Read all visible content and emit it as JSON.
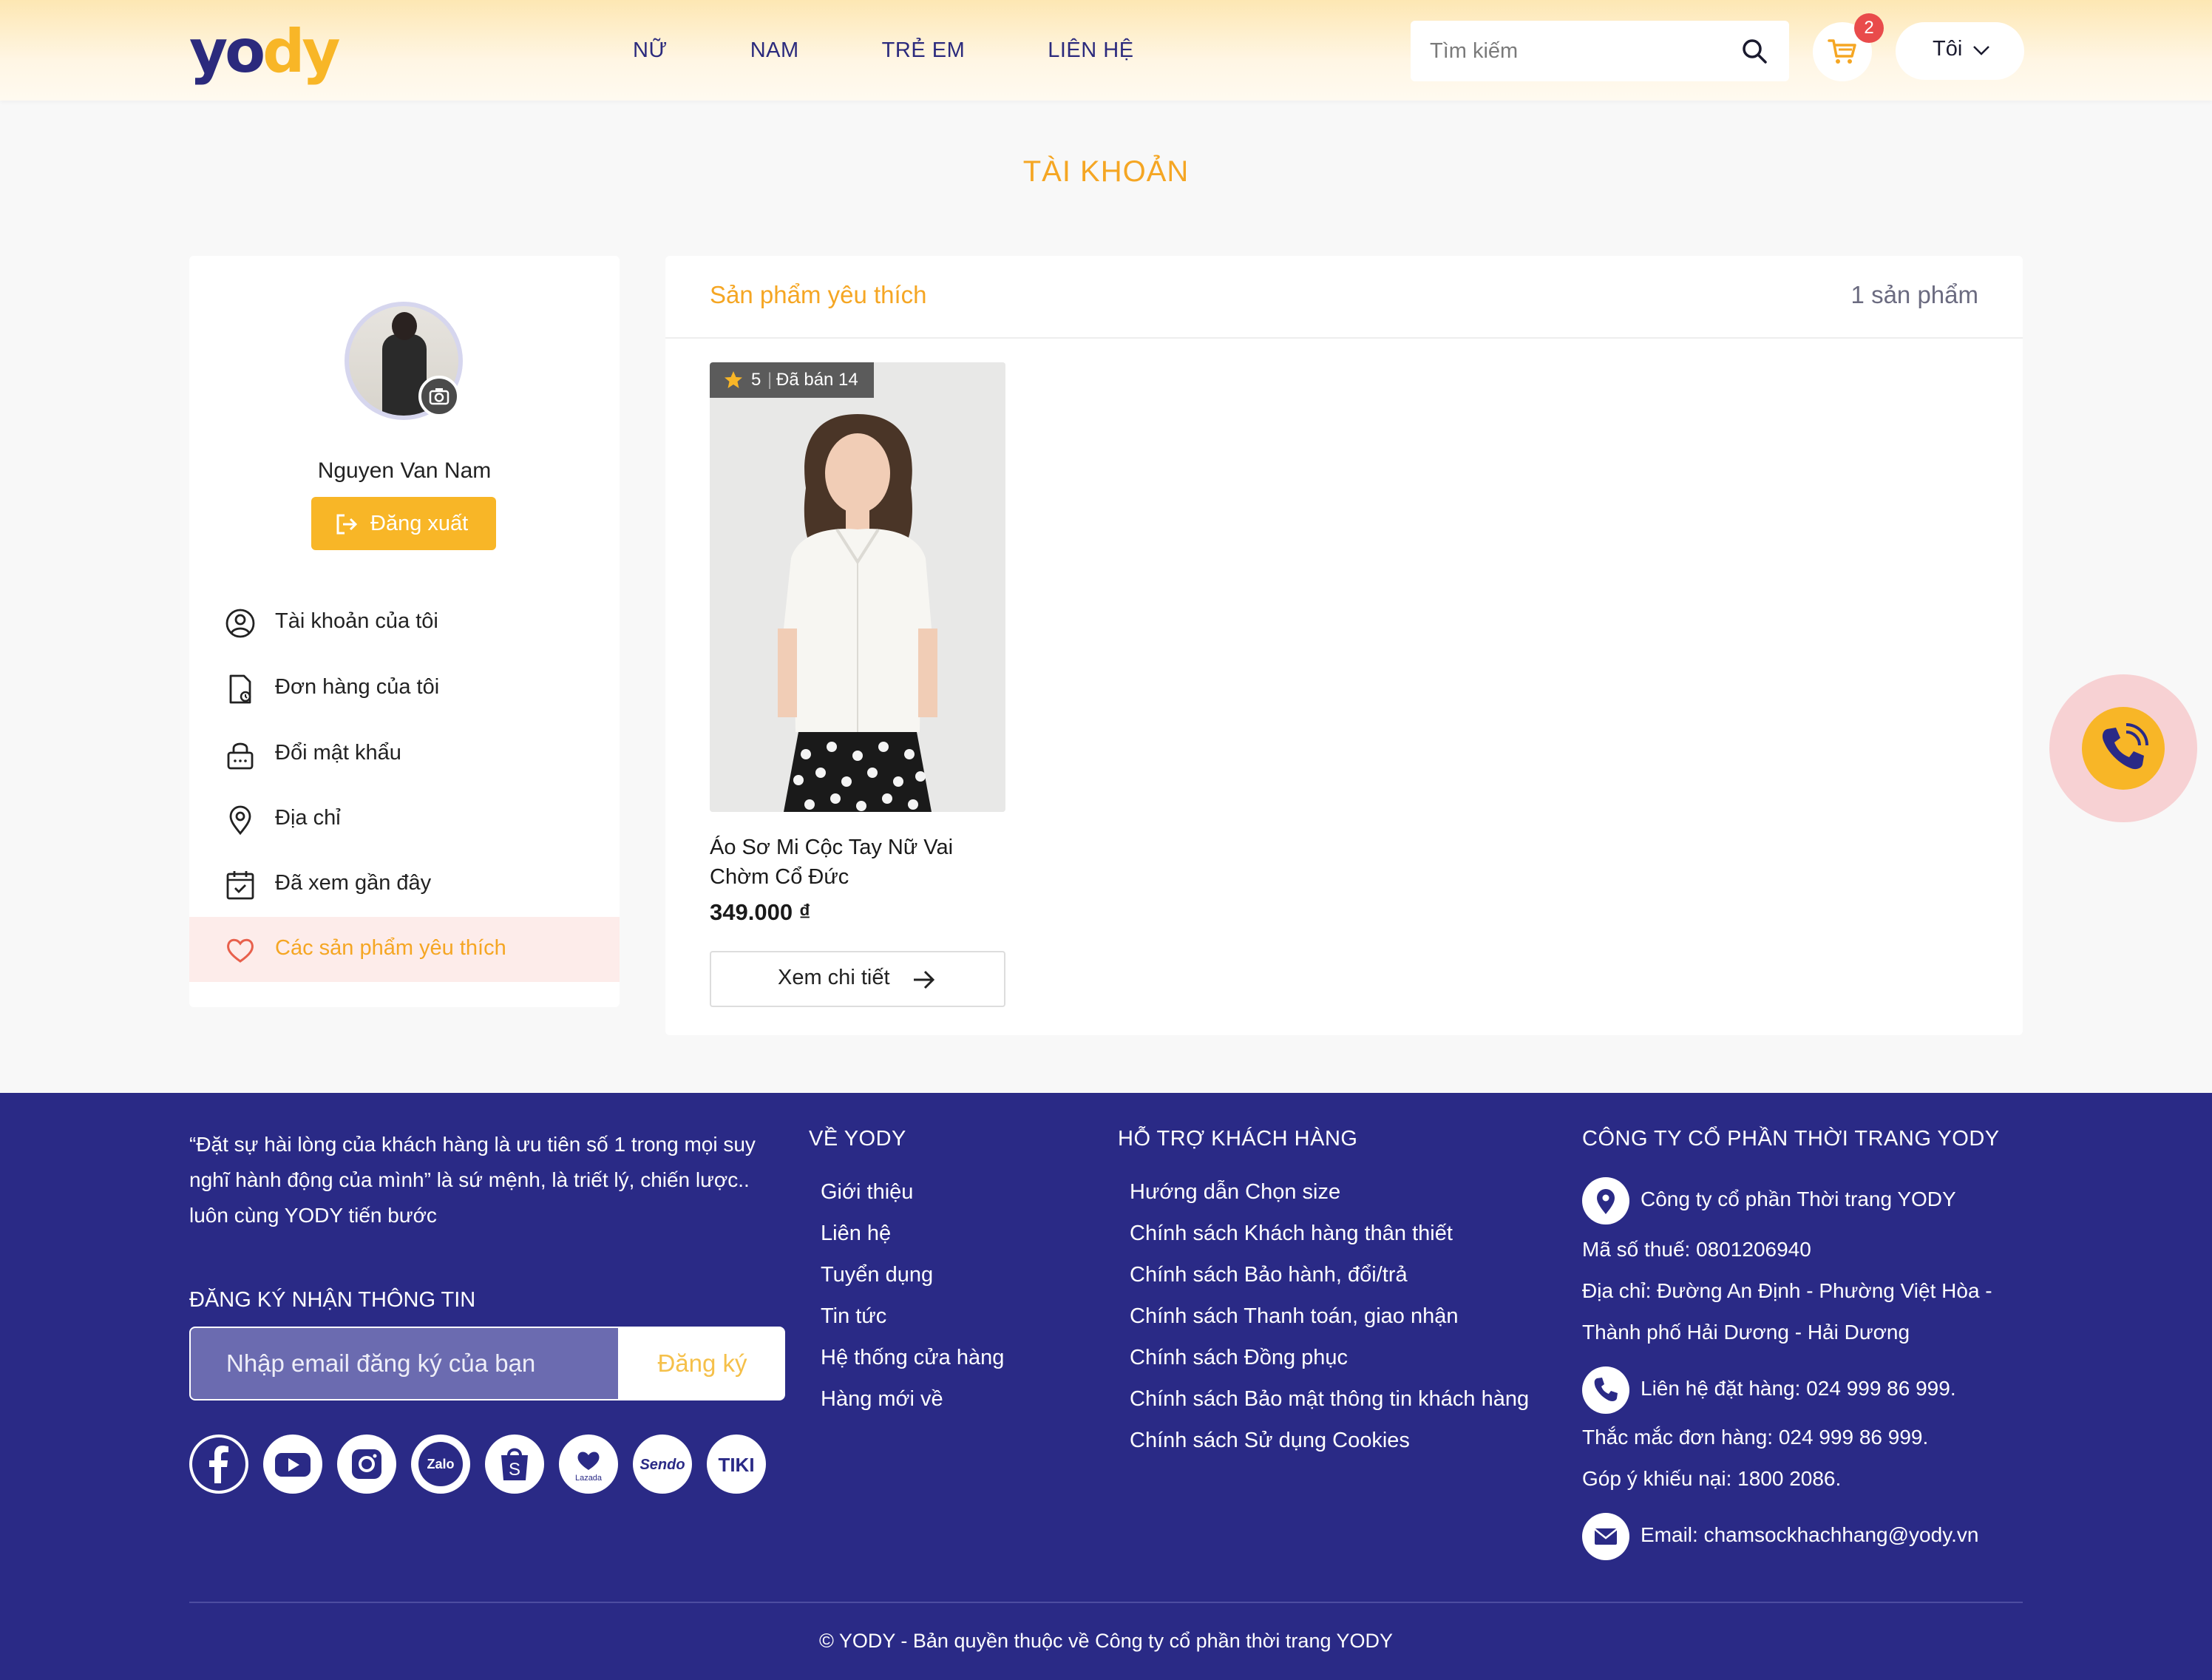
{
  "header": {
    "logo": {
      "y": "y",
      "o": "o",
      "d": "d",
      "y2": "y"
    },
    "nav": [
      "NỮ",
      "NAM",
      "TRẺ EM",
      "LIÊN HỆ"
    ],
    "search_placeholder": "Tìm kiếm",
    "cart_count": "2",
    "user_label": "Tôi"
  },
  "page_title": "TÀI KHOẢN",
  "sidebar": {
    "user_name": "Nguyen Van Nam",
    "logout_label": "Đăng xuất",
    "menu": [
      {
        "label": "Tài khoản của tôi",
        "icon": "user-circle-icon"
      },
      {
        "label": "Đơn hàng của tôi",
        "icon": "order-document-icon"
      },
      {
        "label": "Đổi mật khẩu",
        "icon": "lock-icon"
      },
      {
        "label": "Địa chỉ",
        "icon": "location-pin-icon"
      },
      {
        "label": "Đã xem gần đây",
        "icon": "recently-viewed-icon"
      },
      {
        "label": "Các sản phẩm yêu thích",
        "icon": "heart-icon",
        "active": true
      }
    ]
  },
  "wishlist": {
    "title": "Sản phẩm yêu thích",
    "count_label": "1 sản phẩm",
    "products": [
      {
        "rating": "5",
        "sold": "Đã bán 14",
        "name": "Áo Sơ Mi Cộc Tay Nữ Vai Chờm Cổ Đức",
        "price": "349.000 ₫",
        "button": "Xem chi tiết"
      }
    ]
  },
  "footer": {
    "quote": "“Đặt sự hài lòng của khách hàng là ưu tiên số 1 trong mọi suy nghĩ hành động của mình” là sứ mệnh, là triết lý, chiến lược.. luôn cùng YODY tiến bước",
    "subscribe_title": "ĐĂNG KÝ NHẬN THÔNG TIN",
    "email_placeholder": "Nhập email đăng ký của bạn",
    "subscribe_button": "Đăng ký",
    "socials": [
      "facebook",
      "youtube",
      "instagram",
      "Zalo",
      "shopee",
      "Lazada",
      "Sendo",
      "TIKI"
    ],
    "about_title": "VỀ YODY",
    "about_links": [
      "Giới thiệu",
      "Liên hệ",
      "Tuyển dụng",
      "Tin tức",
      "Hệ thống cửa hàng",
      "Hàng mới về"
    ],
    "support_title": "HỖ TRỢ KHÁCH HÀNG",
    "support_links": [
      "Hướng dẫn Chọn size",
      "Chính sách Khách hàng thân thiết",
      "Chính sách Bảo hành, đổi/trả",
      "Chính sách Thanh toán, giao nhận",
      "Chính sách Đồng phục",
      "Chính sách Bảo mật thông tin khách hàng",
      "Chính sách Sử dụng Cookies"
    ],
    "company_title": "CÔNG TY CỔ PHẦN THỜI TRANG YODY",
    "company_name": "Công ty cổ phần Thời trang YODY",
    "tax": "Mã số thuế: 0801206940",
    "address_1": "Địa chỉ: Đường An Định - Phường Việt Hòa -",
    "address_2": "Thành phố Hải Dương - Hải Dương",
    "phone_order": "Liên hệ đặt hàng: 024 999 86 999.",
    "phone_query": "Thắc mắc đơn hàng: 024 999 86 999.",
    "phone_complaint": "Góp ý khiếu nại: 1800 2086.",
    "email": "Email: chamsockhachhang@yody.vn",
    "copyright": "© YODY - Bản quyền thuộc về Công ty cổ phần thời trang YODY"
  },
  "colors": {
    "brand_navy": "#2a2a86",
    "accent_orange": "#f5a623",
    "button_yellow": "#f8b627"
  }
}
